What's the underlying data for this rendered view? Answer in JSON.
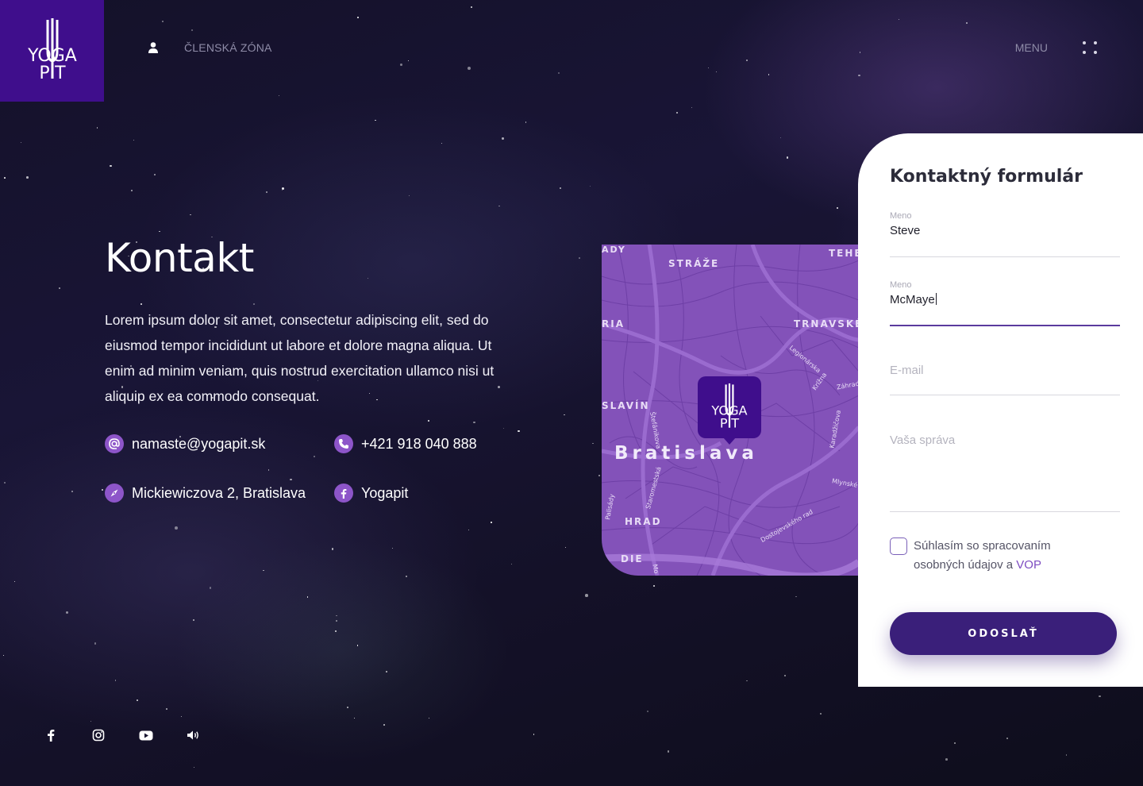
{
  "brand": {
    "logo_line1": "YOGA",
    "logo_line2": "PIT",
    "primary": "#3f0e8c",
    "accent": "#8d55c9"
  },
  "header": {
    "member_icon": "user-icon",
    "member_label": "ČLENSKÁ ZÓNA",
    "menu_label": "MENU",
    "menu_icon": "grid-dots-icon"
  },
  "main": {
    "title": "Kontakt",
    "lead": "Lorem ipsum dolor sit amet, consectetur adipiscing elit, sed do eiusmod tempor incididunt ut labore et dolore magna aliqua. Ut enim ad minim veniam, quis nostrud exercitation ullamco nisi ut aliquip ex ea commodo consequat.",
    "contacts": [
      {
        "icon": "at-icon",
        "text": "namaste@yogapit.sk"
      },
      {
        "icon": "phone-icon",
        "text": "+421 918 040 888"
      },
      {
        "icon": "compass-icon",
        "text": "Mickiewiczova 2, Bratislava"
      },
      {
        "icon": "facebook-icon",
        "text": "Yogapit"
      }
    ]
  },
  "social": [
    "facebook-icon",
    "instagram-icon",
    "youtube-icon",
    "sound-icon"
  ],
  "map": {
    "city": "Bratislava",
    "labels": [
      "ADY",
      "STRÁŽE",
      "TEHE",
      "RIA",
      "TRNAVSKÉ",
      "SLAVÍN",
      "HRAD",
      "DIE"
    ],
    "streets": [
      "Legionárska",
      "Krížna",
      "Záhrad",
      "Štefánikova",
      "Karadžičova",
      "Mlynské",
      "Palisády",
      "Staromestská",
      "Dostojevského rad",
      "Mo"
    ]
  },
  "form": {
    "title": "Kontaktný formulár",
    "first_name_label": "Meno",
    "first_name_value": "Steve",
    "last_name_label": "Meno",
    "last_name_value": "McMaye",
    "email_placeholder": "E-mail",
    "message_placeholder": "Vaša správa",
    "consent_text": "Súhlasím so spracovaním osobných údajov a ",
    "consent_link": "VOP",
    "submit_label": "ODOSLAŤ"
  }
}
